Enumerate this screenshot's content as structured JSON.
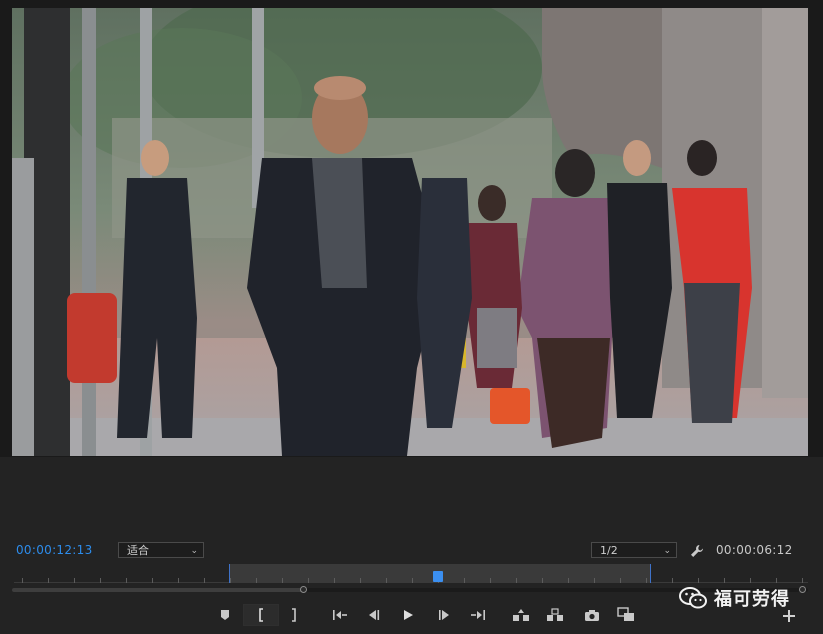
{
  "monitor": {
    "current_timecode": "00:00:12:13",
    "duration_timecode": "00:00:06:12",
    "fit_select": {
      "value": "适合"
    },
    "resolution_select": {
      "value": "1/2"
    }
  },
  "ruler": {
    "playhead_position": 0.534
  },
  "controls": [
    {
      "name": "add-marker-icon"
    },
    {
      "name": "mark-in-icon"
    },
    {
      "name": "mark-out-icon"
    },
    {
      "name": "go-to-in-icon"
    },
    {
      "name": "step-back-icon"
    },
    {
      "name": "play-icon"
    },
    {
      "name": "step-forward-icon"
    },
    {
      "name": "go-to-out-icon"
    },
    {
      "name": "lift-icon"
    },
    {
      "name": "extract-icon"
    },
    {
      "name": "export-frame-icon"
    },
    {
      "name": "comparison-view-icon"
    }
  ],
  "watermark": {
    "text": "福可劳得"
  },
  "colors": {
    "timecode_blue": "#2d8ceb",
    "playhead_blue": "#3b8ff0",
    "panel_bg": "#232323"
  }
}
